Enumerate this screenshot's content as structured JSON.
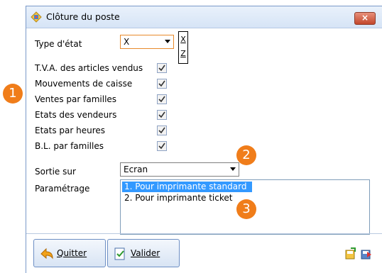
{
  "window": {
    "title": "Clôture du poste",
    "close_label": "×"
  },
  "form": {
    "type_etat_label": "Type d'état",
    "type_etat_value": "X",
    "xz_values": [
      "X",
      "Z"
    ],
    "checkboxes": [
      {
        "label": "T.V.A. des articles vendus",
        "checked": true
      },
      {
        "label": "Mouvements de caisse",
        "checked": true
      },
      {
        "label": "Ventes par familles",
        "checked": true
      },
      {
        "label": "Etats des vendeurs",
        "checked": true
      },
      {
        "label": "Etats par heures",
        "checked": true
      },
      {
        "label": "B.L. par familles",
        "checked": true
      }
    ],
    "sortie_label": "Sortie sur",
    "sortie_value": "Ecran",
    "parametrage_label": "Paramétrage",
    "parametrage_options": [
      "1. Pour imprimante standard",
      "2. Pour imprimante ticket"
    ],
    "parametrage_selected": "1. Pour imprimante standard"
  },
  "buttons": {
    "quit_label": "Quitter",
    "validate_label": "Valider"
  },
  "badges": [
    "1",
    "2",
    "3"
  ],
  "colors": {
    "badge": "#f07d1a",
    "selection": "#3399ff",
    "close": "#c2472c"
  }
}
